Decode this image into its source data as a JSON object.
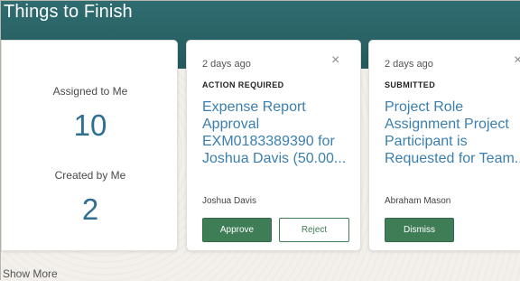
{
  "header": {
    "title": "Things to Finish"
  },
  "summary": {
    "assigned_label": "Assigned to Me",
    "assigned_count": "10",
    "created_label": "Created by Me",
    "created_count": "2"
  },
  "tasks": [
    {
      "age": "2 days ago",
      "status": "ACTION REQUIRED",
      "title": "Expense Report Approval EXM0183389390 for Joshua Davis (50.00...",
      "person": "Joshua Davis",
      "primary_action": "Approve",
      "secondary_action": "Reject",
      "close_icon": "×"
    },
    {
      "age": "2 days ago",
      "status": "SUBMITTED",
      "title": "Project Role Assignment Project Participant is Requested for Team...",
      "person": "Abraham Mason",
      "primary_action": "Dismiss",
      "close_icon": "×"
    }
  ],
  "footer": {
    "show_more": "Show More"
  },
  "colors": {
    "banner": "#2a6366",
    "link": "#3a7fb0",
    "count": "#2f6f93",
    "button_green": "#3f7d57"
  },
  "icons": {
    "close": "close-icon"
  }
}
